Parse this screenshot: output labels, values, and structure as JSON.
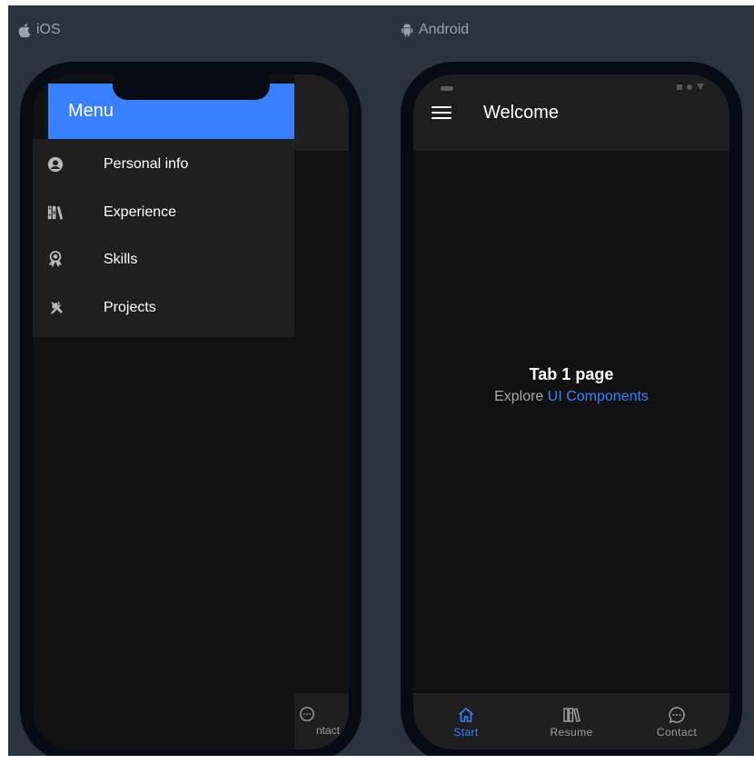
{
  "platforms": {
    "ios_label": "iOS",
    "android_label": "Android"
  },
  "ios": {
    "menu": {
      "title": "Menu",
      "items": [
        {
          "label": "Personal info",
          "icon": "person-circle-icon"
        },
        {
          "label": "Experience",
          "icon": "library-icon"
        },
        {
          "label": "Skills",
          "icon": "ribbon-icon"
        },
        {
          "label": "Projects",
          "icon": "construct-icon"
        }
      ]
    },
    "tabbar_peek_label": "ntact"
  },
  "android": {
    "toolbar": {
      "title": "Welcome"
    },
    "content": {
      "heading": "Tab 1 page",
      "explore_text": "Explore",
      "link_text": "UI Components"
    },
    "tabs": [
      {
        "label": "Start",
        "icon": "home-icon",
        "active": true
      },
      {
        "label": "Resume",
        "icon": "library-icon",
        "active": false
      },
      {
        "label": "Contact",
        "icon": "chat-bubble-icon",
        "active": false
      }
    ]
  },
  "colors": {
    "primary": "#3880ff",
    "background": "#2b333e",
    "toolbar": "#1f1f1f",
    "content": "#121212"
  }
}
